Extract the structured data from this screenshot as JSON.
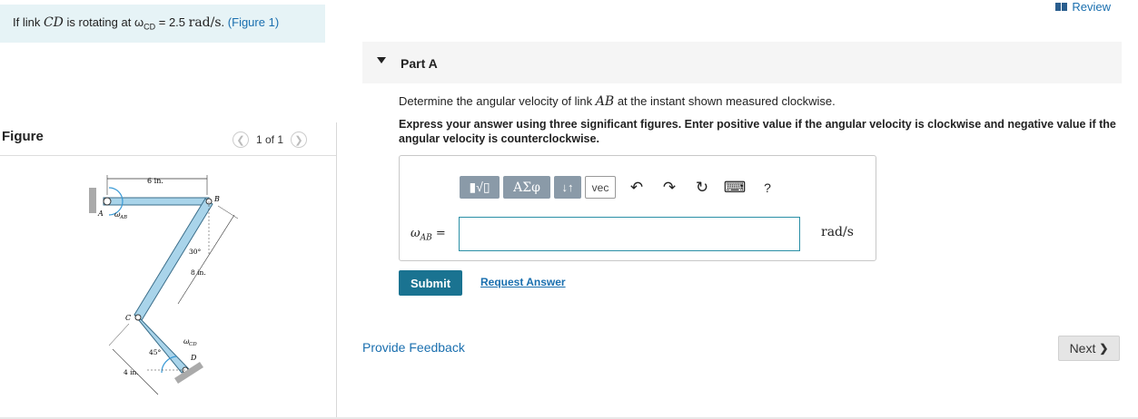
{
  "problem": {
    "prefix": "If link",
    "link_name": "CD",
    "mid": "is rotating at ω",
    "omega_sub": "CD",
    "value": "= 2.5",
    "unit": "rad/s",
    "suffix": ".",
    "figure_link": "(Figure 1)"
  },
  "figure": {
    "title": "Figure",
    "pager": "1 of 1",
    "prev_icon": "chevron-left",
    "next_icon": "chevron-right",
    "labels": {
      "dim_top": "6 in.",
      "point_a": "A",
      "omega_ab": "ω",
      "omega_ab_sub": "AB",
      "point_b": "B",
      "angle_30": "30°",
      "dim_8": "8 in.",
      "point_c": "C",
      "omega_cd": "ω",
      "omega_cd_sub": "CD",
      "point_d": "D",
      "angle_45": "45°",
      "dim_4": "4 in."
    }
  },
  "review": {
    "label": "Review",
    "icon": "book-icon"
  },
  "part": {
    "label": "Part A"
  },
  "question": {
    "prefix": "Determine the angular velocity of link",
    "link": "AB",
    "suffix": "at the instant shown measured clockwise."
  },
  "instruction": "Express your answer using three significant figures. Enter positive value if the angular velocity is clockwise and negative value if the angular velocity is counterclockwise.",
  "toolbar": {
    "templates": "▮√▯",
    "greek": "ΑΣφ",
    "arrows": "↓↑",
    "vec": "vec",
    "undo": "↶",
    "redo": "↷",
    "reset": "↻",
    "keyboard": "⌨",
    "help": "?"
  },
  "answer": {
    "label": "ω",
    "label_sub": "AB",
    "label_eq": "=",
    "value": "",
    "unit": "rad/s"
  },
  "buttons": {
    "submit": "Submit",
    "request": "Request Answer",
    "feedback": "Provide Feedback",
    "next": "Next",
    "next_icon": "❯"
  }
}
